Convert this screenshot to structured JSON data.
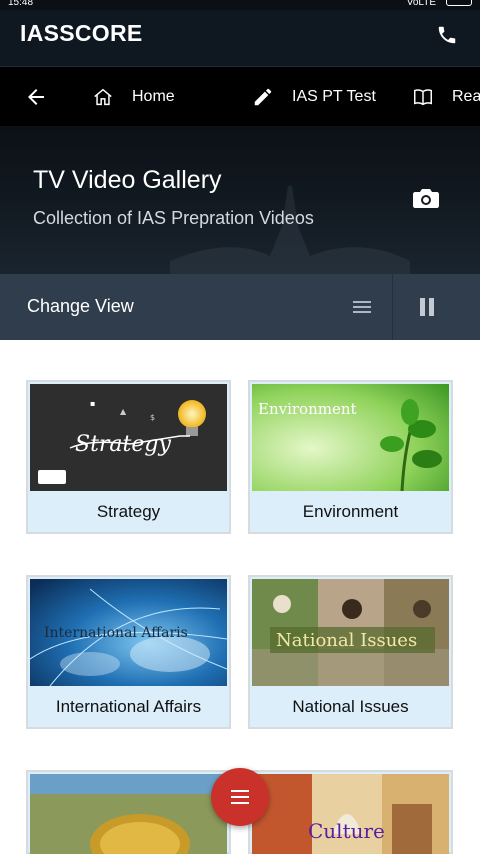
{
  "status_bar": {
    "time": "15:48",
    "network": "VoLTE"
  },
  "app": {
    "brand": "IASSCORE"
  },
  "nav": {
    "items": [
      {
        "label": "Home",
        "icon": "home-icon"
      },
      {
        "label": "IAS PT Test",
        "icon": "pencil-icon"
      },
      {
        "label": "Rea",
        "icon": "book-icon"
      }
    ]
  },
  "hero": {
    "title": "TV Video Gallery",
    "subtitle": "Collection of IAS Prepration Videos"
  },
  "view_bar": {
    "label": "Change View"
  },
  "gallery": {
    "cards": [
      {
        "caption": "Strategy",
        "thumb_text": "Strategy"
      },
      {
        "caption": "Environment",
        "thumb_text": "Environment"
      },
      {
        "caption": "International Affairs",
        "thumb_text": "International Affaris"
      },
      {
        "caption": "National Issues",
        "thumb_text": "National Issues"
      },
      {
        "caption": "",
        "thumb_text": ""
      },
      {
        "caption": "",
        "thumb_text": "Culture"
      }
    ]
  },
  "colors": {
    "header_bg": "#0f1720",
    "nav_bg": "#000000",
    "view_bar_bg": "#2f3d4c",
    "card_caption_bg": "#dbeefa",
    "fab": "#c9312a"
  }
}
